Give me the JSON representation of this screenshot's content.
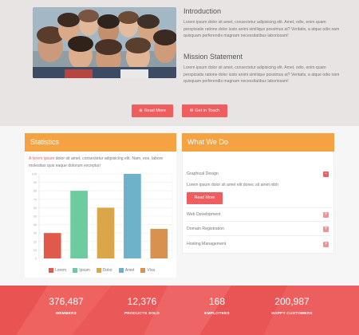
{
  "intro": {
    "title": "Introduction",
    "text": "Lorem ipsum dolor sit amet, consectetur adipisicing elit. Amet, odio, enim quam perspiciatis ratione dolor iusto animi similique possimus at? Veritatis, a atque odio nam quisquam perferendis magnam necessitatibus laboriosam!"
  },
  "mission": {
    "title": "Mission Statement",
    "text": "Lorem ipsum dolor sit amet, consectetur adipisicing elit. Amet, odio, enim quam perspiciatis ratione dolor iusto animi similique possimus at? Veritatis, a atque odio nam quisquam perferendis magnam necessitatibus laboriosam!"
  },
  "buttons": {
    "read_more": "Read More",
    "get_in_touch": "Get in Touch"
  },
  "statistics": {
    "title": "Statistics",
    "text_red": "A lorem ipsum",
    "text_rest": " dolor sit amet, consectetur adipisicing elit. Nam, eos, labore molestias quis eaque dolorum excepturi"
  },
  "what_we_do": {
    "title": "What We Do",
    "items": [
      {
        "label": "Graphical Design",
        "icon": "minus-icon",
        "btn": "−"
      },
      {
        "label": "Web Development",
        "icon": "plus-icon",
        "btn": "+"
      },
      {
        "label": "Domain Registration",
        "icon": "plus-icon",
        "btn": "+"
      },
      {
        "label": "Hosting Management",
        "icon": "plus-icon",
        "btn": "+"
      }
    ],
    "open_desc": "Lorem ipsum dolor sit amet elit donec sit amet nibh",
    "open_button": "Read More"
  },
  "chart_data": {
    "type": "bar",
    "categories": [
      "Lorem",
      "Ipsum",
      "Dolor",
      "Amet",
      "Viva"
    ],
    "values": [
      30,
      80,
      60,
      100,
      35
    ],
    "colors": [
      "#e05a4b",
      "#6ccb9f",
      "#dba54a",
      "#6db2c9",
      "#d99150"
    ],
    "yticks": [
      0,
      10,
      20,
      30,
      40,
      50,
      60,
      70,
      80,
      90,
      100
    ],
    "ylim": [
      0,
      100
    ],
    "grid": true,
    "legend": "bottom"
  },
  "counters": [
    {
      "value": "376,487",
      "label": "MEMBERS"
    },
    {
      "value": "12,376",
      "label": "PRODUCTS SOLD"
    },
    {
      "value": "168",
      "label": "EMPLOYEES"
    },
    {
      "value": "200,987",
      "label": "HAPPY CUSTOMERS"
    }
  ],
  "colors": {
    "accent": "#ef5d5e",
    "panel_header": "#f5a243",
    "top_bg": "#e7e4e3",
    "bottom_bg": "#ec5a5b"
  }
}
